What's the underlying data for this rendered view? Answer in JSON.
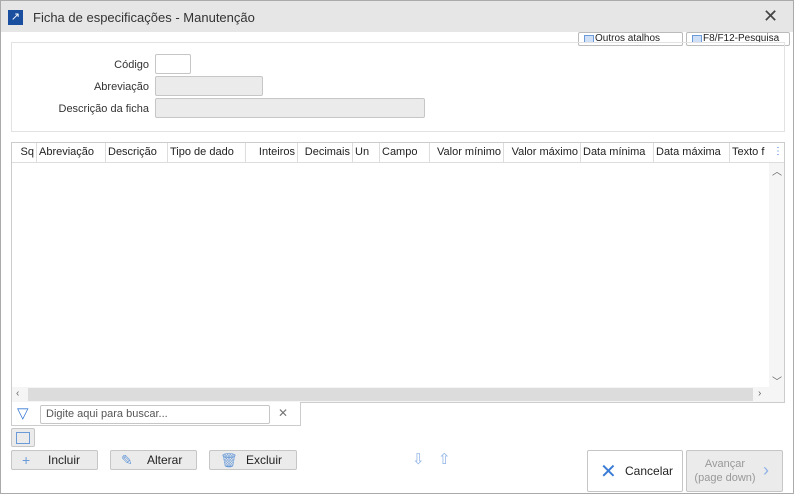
{
  "window": {
    "title": "Ficha de especificações - Manutenção"
  },
  "shortcuts": {
    "outros": "Outros atalhos",
    "pesquisa": "F8/F12-Pesquisa"
  },
  "form": {
    "codigo_label": "Código",
    "abreviacao_label": "Abreviação",
    "descricao_label": "Descrição da ficha",
    "codigo": "",
    "abreviacao": "",
    "descricao": ""
  },
  "grid": {
    "columns": [
      "Sq",
      "Abreviação",
      "Descrição",
      "Tipo de dado",
      "Inteiros",
      "Decimais",
      "Un",
      "Campo",
      "Valor mínimo",
      "Valor máximo",
      "Data mínima",
      "Data máxima",
      "Texto f"
    ],
    "rows": []
  },
  "search": {
    "placeholder": "Digite aqui para buscar..."
  },
  "actions": {
    "incluir": "Incluir",
    "alterar": "Alterar",
    "excluir": "Excluir",
    "cancelar": "Cancelar",
    "avancar": "Avançar",
    "avancar_sub": "(page down)"
  }
}
